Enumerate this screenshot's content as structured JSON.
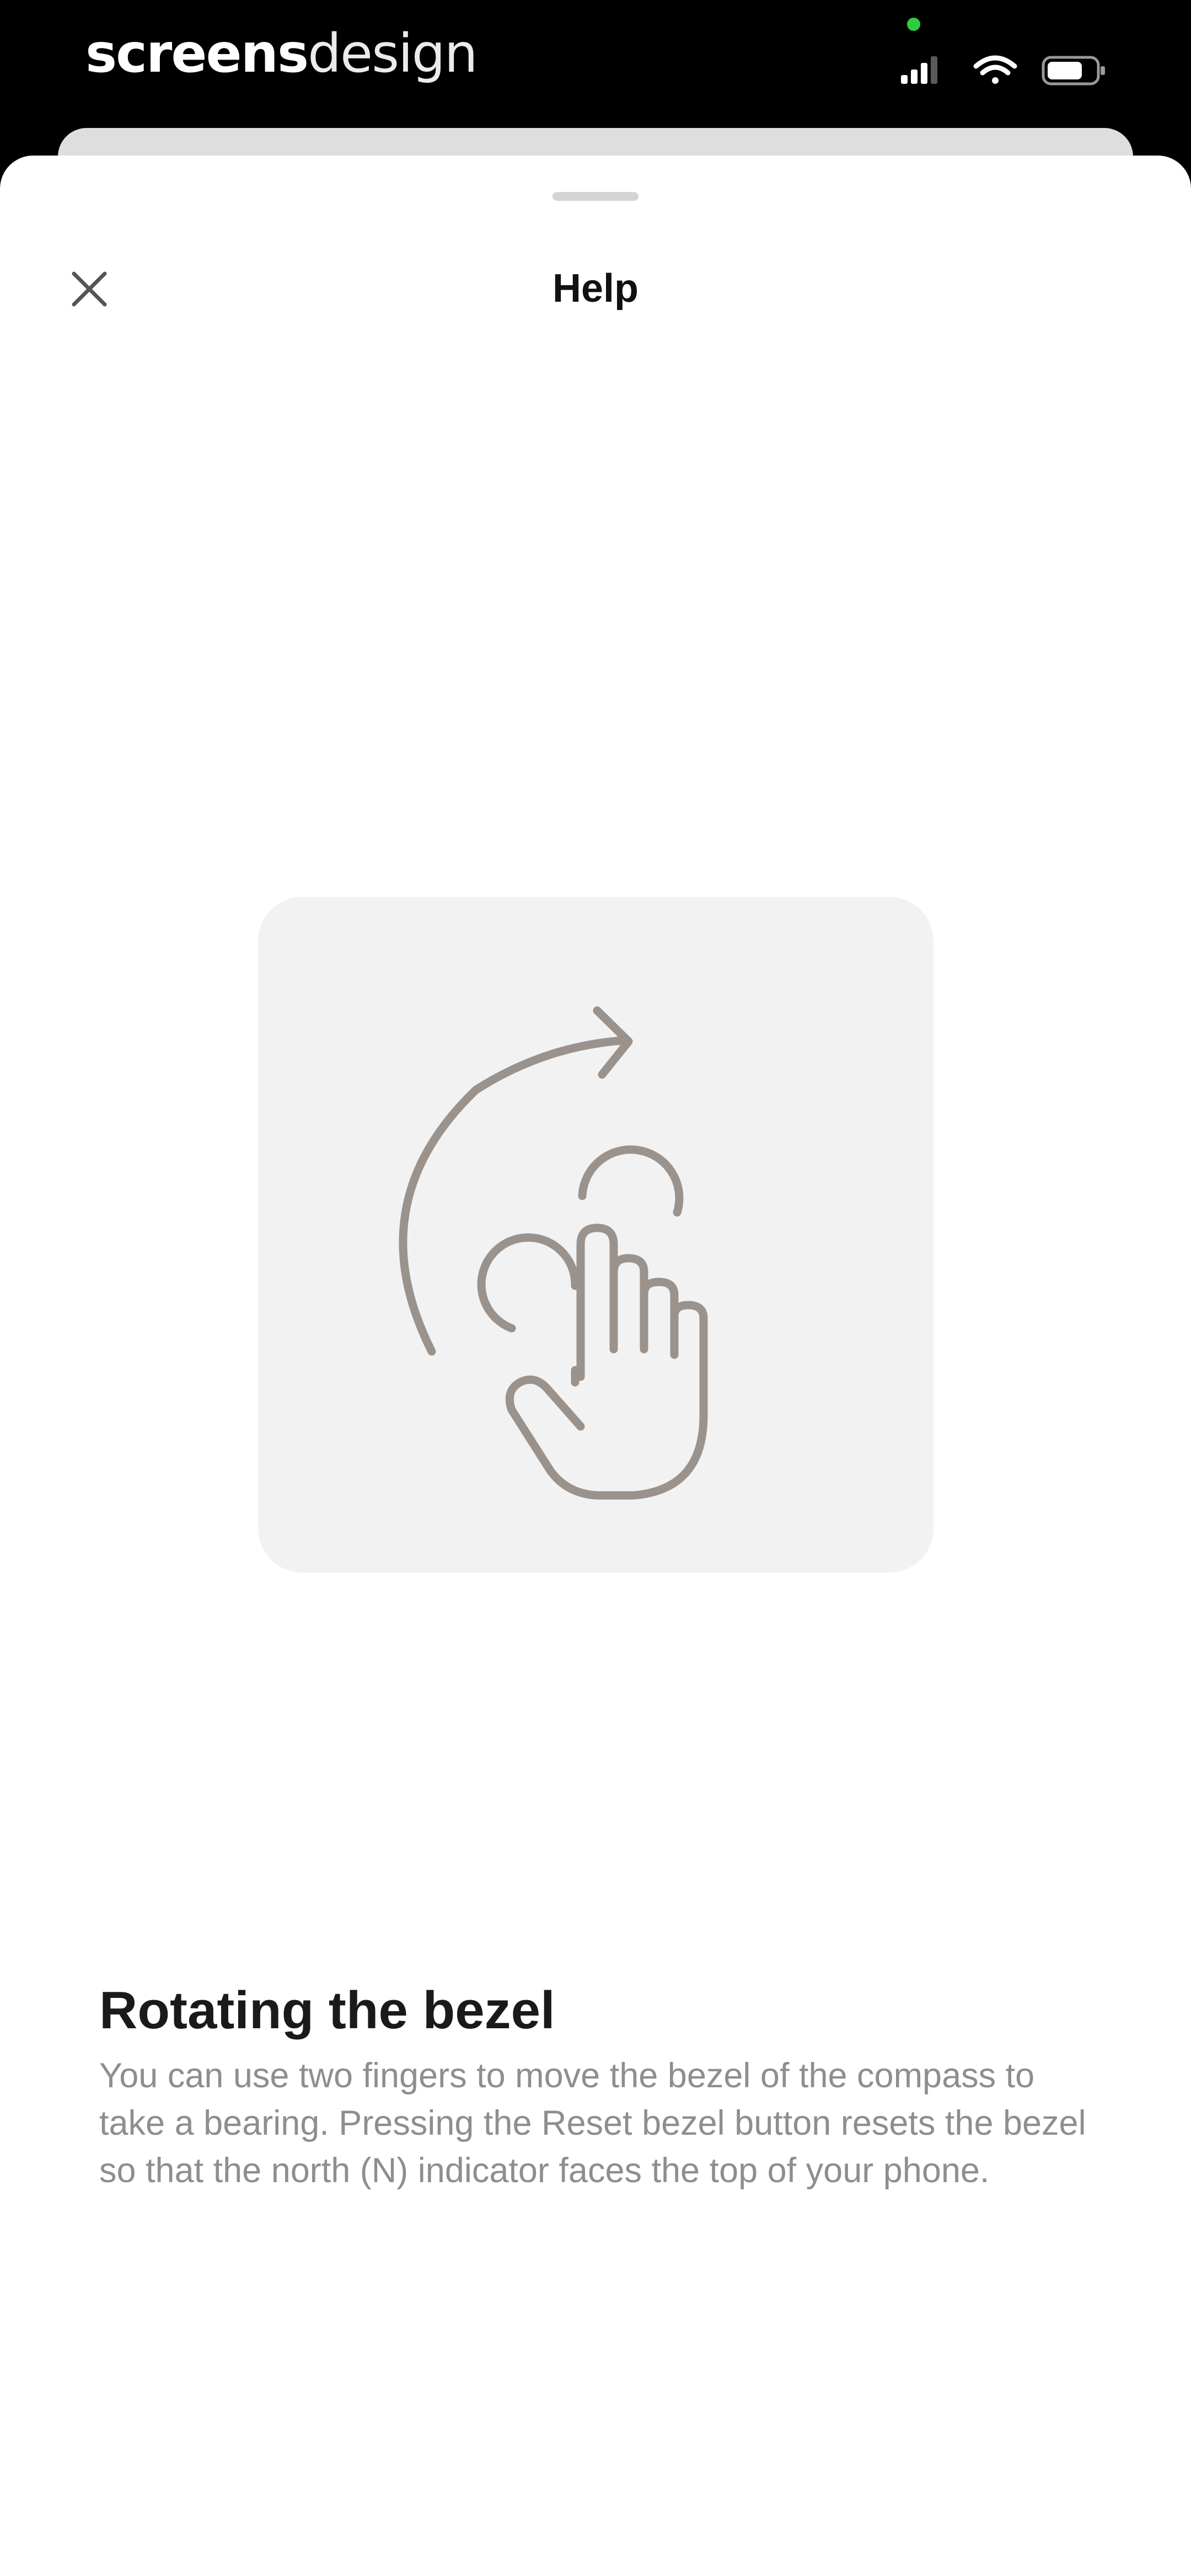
{
  "status_bar": {
    "brand_bold": "screens",
    "brand_light": "design",
    "icons": [
      "cellular-signal-icon",
      "wifi-icon",
      "battery-icon"
    ],
    "privacy_indicator_color": "#2ecc40"
  },
  "header": {
    "title": "Help",
    "close_icon": "close-icon"
  },
  "illustration": {
    "icon": "two-finger-rotate-gesture-icon",
    "card_color": "#f2f2f2",
    "stroke_color": "#9b928c"
  },
  "content": {
    "heading": "Rotating the bezel",
    "body": "You can use two fingers to move the bezel of the compass to take a bearing. Pressing the Reset bezel button resets the bezel so that the north (N) indicator faces the top of your phone."
  }
}
